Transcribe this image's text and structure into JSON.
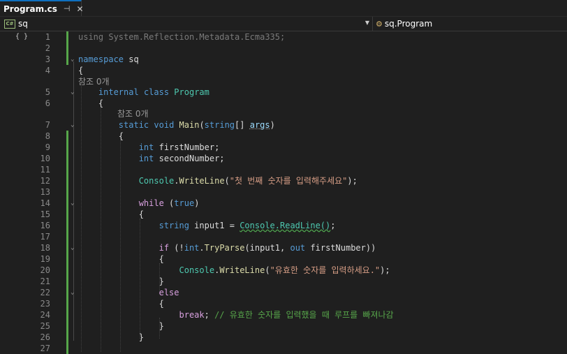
{
  "tab": {
    "title": "Program.cs",
    "pin_icon": "pin-icon",
    "close_icon": "close-icon"
  },
  "navbar": {
    "project_badge": "C#",
    "project": "sq",
    "type": "sq.Program",
    "type_icon": "class-icon"
  },
  "editor": {
    "margin_glyph": "{ }",
    "lens": {
      "line4": "참조 0개",
      "line6": "참조 0개"
    },
    "lines": [
      {
        "n": "1",
        "tokens": [
          [
            "using",
            "dim"
          ],
          [
            " System.Reflection.Metadata.Ecma335;",
            "dim"
          ]
        ]
      },
      {
        "n": "2",
        "tokens": []
      },
      {
        "n": "3",
        "tokens": [
          [
            "namespace",
            "k"
          ],
          [
            " sq",
            ""
          ]
        ]
      },
      {
        "n": "4",
        "tokens": [
          [
            "{",
            ""
          ]
        ]
      },
      {
        "n": "5",
        "tokens": [
          [
            "    ",
            ""
          ],
          [
            "internal",
            "k"
          ],
          [
            " ",
            ""
          ],
          [
            "class",
            "k"
          ],
          [
            " ",
            ""
          ],
          [
            "Program",
            "t"
          ]
        ]
      },
      {
        "n": "6",
        "tokens": [
          [
            "    {",
            ""
          ]
        ]
      },
      {
        "n": "7",
        "tokens": [
          [
            "        ",
            ""
          ],
          [
            "static",
            "k"
          ],
          [
            " ",
            ""
          ],
          [
            "void",
            "k"
          ],
          [
            " ",
            ""
          ],
          [
            "Main",
            "m"
          ],
          [
            "(",
            ""
          ],
          [
            "string",
            "k"
          ],
          [
            "[] ",
            ""
          ],
          [
            "args",
            "sqg"
          ],
          [
            ")",
            ""
          ]
        ]
      },
      {
        "n": "8",
        "tokens": [
          [
            "        {",
            ""
          ]
        ]
      },
      {
        "n": "9",
        "tokens": [
          [
            "            ",
            ""
          ],
          [
            "int",
            "k"
          ],
          [
            " firstNumber;",
            ""
          ]
        ]
      },
      {
        "n": "10",
        "tokens": [
          [
            "            ",
            ""
          ],
          [
            "int",
            "k"
          ],
          [
            " secondNumber;",
            ""
          ]
        ]
      },
      {
        "n": "11",
        "tokens": []
      },
      {
        "n": "12",
        "tokens": [
          [
            "            ",
            ""
          ],
          [
            "Console",
            "t"
          ],
          [
            ".",
            ""
          ],
          [
            "WriteLine",
            "m"
          ],
          [
            "(",
            ""
          ],
          [
            "\"첫 번째 숫자를 입력해주세요\"",
            "s"
          ],
          [
            ");",
            ""
          ]
        ]
      },
      {
        "n": "13",
        "tokens": []
      },
      {
        "n": "14",
        "tokens": [
          [
            "            ",
            ""
          ],
          [
            "while",
            "c"
          ],
          [
            " (",
            ""
          ],
          [
            "true",
            "k"
          ],
          [
            ")",
            ""
          ]
        ]
      },
      {
        "n": "15",
        "tokens": [
          [
            "            {",
            ""
          ]
        ]
      },
      {
        "n": "16",
        "tokens": [
          [
            "                ",
            ""
          ],
          [
            "string",
            "k"
          ],
          [
            " input1 = ",
            ""
          ],
          [
            "Console.ReadLine()",
            "sqt"
          ],
          [
            ";",
            ""
          ]
        ]
      },
      {
        "n": "17",
        "tokens": []
      },
      {
        "n": "18",
        "tokens": [
          [
            "                ",
            ""
          ],
          [
            "if",
            "c"
          ],
          [
            " (!",
            ""
          ],
          [
            "int",
            "k"
          ],
          [
            ".",
            ""
          ],
          [
            "TryParse",
            "m"
          ],
          [
            "(input1, ",
            ""
          ],
          [
            "out",
            "k"
          ],
          [
            " firstNumber))",
            ""
          ]
        ]
      },
      {
        "n": "19",
        "tokens": [
          [
            "                {",
            ""
          ]
        ]
      },
      {
        "n": "20",
        "tokens": [
          [
            "                    ",
            ""
          ],
          [
            "Console",
            "t"
          ],
          [
            ".",
            ""
          ],
          [
            "WriteLine",
            "m"
          ],
          [
            "(",
            ""
          ],
          [
            "\"유효한 숫자를 입력하세요.\"",
            "s"
          ],
          [
            ");",
            ""
          ]
        ]
      },
      {
        "n": "21",
        "tokens": [
          [
            "                }",
            ""
          ]
        ]
      },
      {
        "n": "22",
        "tokens": [
          [
            "                ",
            ""
          ],
          [
            "else",
            "c"
          ]
        ]
      },
      {
        "n": "23",
        "tokens": [
          [
            "                {",
            ""
          ]
        ]
      },
      {
        "n": "24",
        "tokens": [
          [
            "                    ",
            ""
          ],
          [
            "break",
            "c"
          ],
          [
            "; ",
            ""
          ],
          [
            "// 유효한 숫자를 입력했을 때 루프를 빠져나감",
            "g"
          ]
        ]
      },
      {
        "n": "25",
        "tokens": [
          [
            "                }",
            ""
          ]
        ]
      },
      {
        "n": "26",
        "tokens": [
          [
            "            }",
            ""
          ]
        ]
      },
      {
        "n": "27",
        "tokens": []
      }
    ]
  }
}
